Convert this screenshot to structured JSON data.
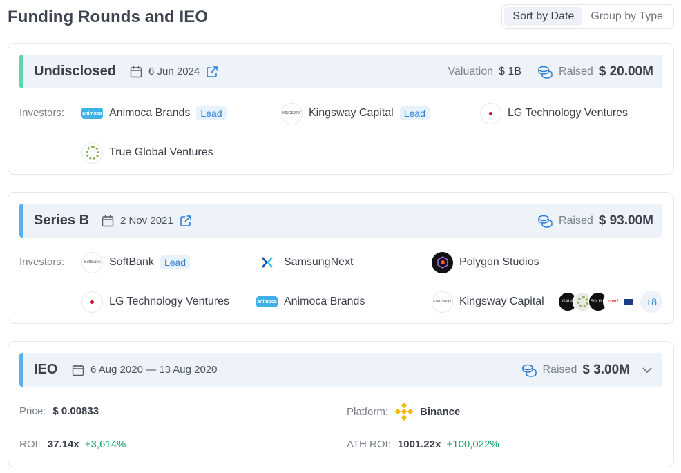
{
  "header": {
    "title": "Funding Rounds and IEO",
    "sort_by_date": "Sort by Date",
    "group_by_type": "Group by Type"
  },
  "rounds": [
    {
      "type": "Undisclosed",
      "date": "6 Jun 2024",
      "valuation_label": "Valuation",
      "valuation": "$ 1B",
      "raised_label": "Raised",
      "raised": "$ 20.00M",
      "investors_label": "Investors:",
      "investors": [
        {
          "name": "Animoca Brands",
          "lead": "Lead"
        },
        {
          "name": "Kingsway Capital",
          "lead": "Lead"
        },
        {
          "name": "LG Technology Ventures"
        },
        {
          "name": "True Global Ventures"
        }
      ]
    },
    {
      "type": "Series B",
      "date": "2 Nov 2021",
      "raised_label": "Raised",
      "raised": "$ 93.00M",
      "investors_label": "Investors:",
      "investors": [
        {
          "name": "SoftBank",
          "lead": "Lead"
        },
        {
          "name": "SamsungNext"
        },
        {
          "name": "Polygon Studios"
        },
        {
          "name": "LG Technology Ventures"
        },
        {
          "name": "Animoca Brands"
        },
        {
          "name": "Kingsway Capital"
        }
      ],
      "more_count": "+8"
    }
  ],
  "ieo": {
    "type": "IEO",
    "date": "6 Aug 2020 — 13 Aug 2020",
    "raised_label": "Raised",
    "raised": "$ 3.00M",
    "price_label": "Price:",
    "price": "$ 0.00833",
    "platform_label": "Platform:",
    "platform": "Binance",
    "roi_label": "ROI:",
    "roi": "37.14x",
    "roi_pct": "+3,614%",
    "ath_roi_label": "ATH ROI:",
    "ath_roi": "1001.22x",
    "ath_roi_pct": "+100,022%"
  },
  "colors": {
    "accent_green": "#5fd4b0",
    "accent_blue": "#5aaef2",
    "link_blue": "#2b7fd4",
    "positive": "#1aa567"
  },
  "icons": [
    "calendar-icon",
    "external-link-icon",
    "coins-icon",
    "chevron-down-icon",
    "binance-icon"
  ]
}
